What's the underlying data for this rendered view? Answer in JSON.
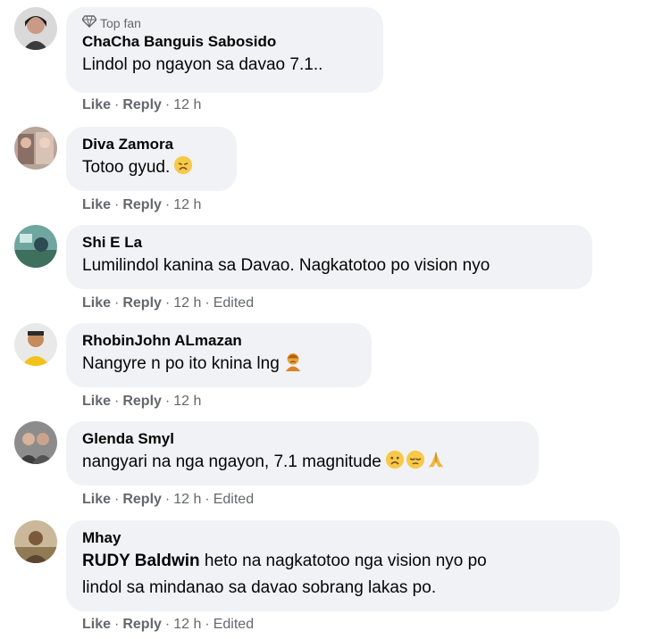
{
  "comments": [
    {
      "badge": "Top fan",
      "author": "ChaCha Banguis Sabosido",
      "text": "Lindol po ngayon sa davao 7.1..",
      "like": "Like",
      "reply": "Reply",
      "time": "12 h",
      "edited": "",
      "emojis": []
    },
    {
      "author": "Diva Zamora",
      "text": "Totoo gyud.",
      "like": "Like",
      "reply": "Reply",
      "time": "12 h",
      "edited": "",
      "emojis": [
        "disappointed-face"
      ]
    },
    {
      "author": "Shi E La",
      "text": "Lumilindol kanina sa Davao. Nagkatotoo po vision nyo",
      "like": "Like",
      "reply": "Reply",
      "time": "12 h",
      "edited": "Edited",
      "emojis": []
    },
    {
      "author": "RhobinJohn ALmazan",
      "text": "Nangyre n po ito knina lng",
      "like": "Like",
      "reply": "Reply",
      "time": "12 h",
      "edited": "",
      "emojis": [
        "person-frowning"
      ]
    },
    {
      "author": "Glenda Smyl",
      "text": "nangyari na nga ngayon, 7.1 magnitude",
      "like": "Like",
      "reply": "Reply",
      "time": "12 h",
      "edited": "Edited",
      "emojis": [
        "sad-face",
        "pensive-face",
        "folded-hands"
      ]
    },
    {
      "author": "Mhay",
      "mention": "RUDY Baldwin",
      "text_line1": " heto na nagkatotoo nga vision nyo po",
      "text_line2": "lindol sa mindanao sa davao sobrang lakas po.",
      "like": "Like",
      "reply": "Reply",
      "time": "12 h",
      "edited": "Edited",
      "emojis": []
    }
  ],
  "colors": {
    "bubble": "#f0f2f5",
    "meta": "#65676b",
    "text": "#050505"
  }
}
